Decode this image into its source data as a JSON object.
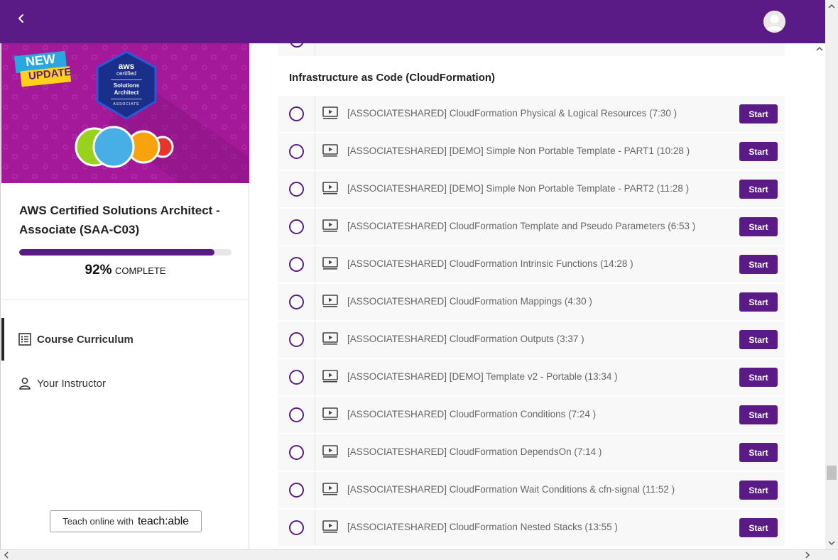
{
  "header": {
    "back_icon": "chevron-left-icon",
    "avatar_icon": "user-avatar-icon",
    "bar_color": "#5b1b86"
  },
  "sidebar": {
    "banner": {
      "badge_new": "NEW",
      "badge_update": "UPDATE",
      "aws_word": "aws",
      "certified": "certified",
      "cert_line1": "Solutions",
      "cert_line2": "Architect",
      "cert_level": "ASSOCIATE"
    },
    "course_title": "AWS Certified Solutions Architect - Associate (SAA-C03)",
    "progress": {
      "percent": 92,
      "percent_label": "92%",
      "complete_label": "COMPLETE"
    },
    "nav": [
      {
        "label": "Course Curriculum",
        "icon": "list-icon",
        "active": true
      },
      {
        "label": "Your Instructor",
        "icon": "person-icon",
        "active": false
      }
    ],
    "teach": {
      "prefix": "Teach online with",
      "brand": "teach:able"
    }
  },
  "main": {
    "section_title": "Infrastructure as Code (CloudFormation)",
    "start_label": "Start",
    "lectures": [
      {
        "title": "[ASSOCIATESHARED] CloudFormation Physical & Logical Resources (7:30 )"
      },
      {
        "title": "[ASSOCIATESHARED] [DEMO] Simple Non Portable Template - PART1 (10:28 )"
      },
      {
        "title": "[ASSOCIATESHARED] [DEMO] Simple Non Portable Template - PART2 (11:28 )"
      },
      {
        "title": "[ASSOCIATESHARED] CloudFormation Template and Pseudo Parameters (6:53 )"
      },
      {
        "title": "[ASSOCIATESHARED] CloudFormation Intrinsic Functions (14:28 )"
      },
      {
        "title": "[ASSOCIATESHARED] CloudFormation Mappings (4:30 )"
      },
      {
        "title": "[ASSOCIATESHARED] CloudFormation Outputs (3:37 )"
      },
      {
        "title": "[ASSOCIATESHARED] [DEMO] Template v2 - Portable (13:34 )"
      },
      {
        "title": "[ASSOCIATESHARED] CloudFormation Conditions (7:24 )"
      },
      {
        "title": "[ASSOCIATESHARED] CloudFormation DependsOn (7:14 )"
      },
      {
        "title": "[ASSOCIATESHARED] CloudFormation Wait Conditions & cfn-signal (11:52 )"
      },
      {
        "title": "[ASSOCIATESHARED] CloudFormation Nested Stacks (13:55 )"
      }
    ]
  },
  "colors": {
    "brand_purple": "#5b1b86",
    "banner_magenta": "#a4199a"
  }
}
